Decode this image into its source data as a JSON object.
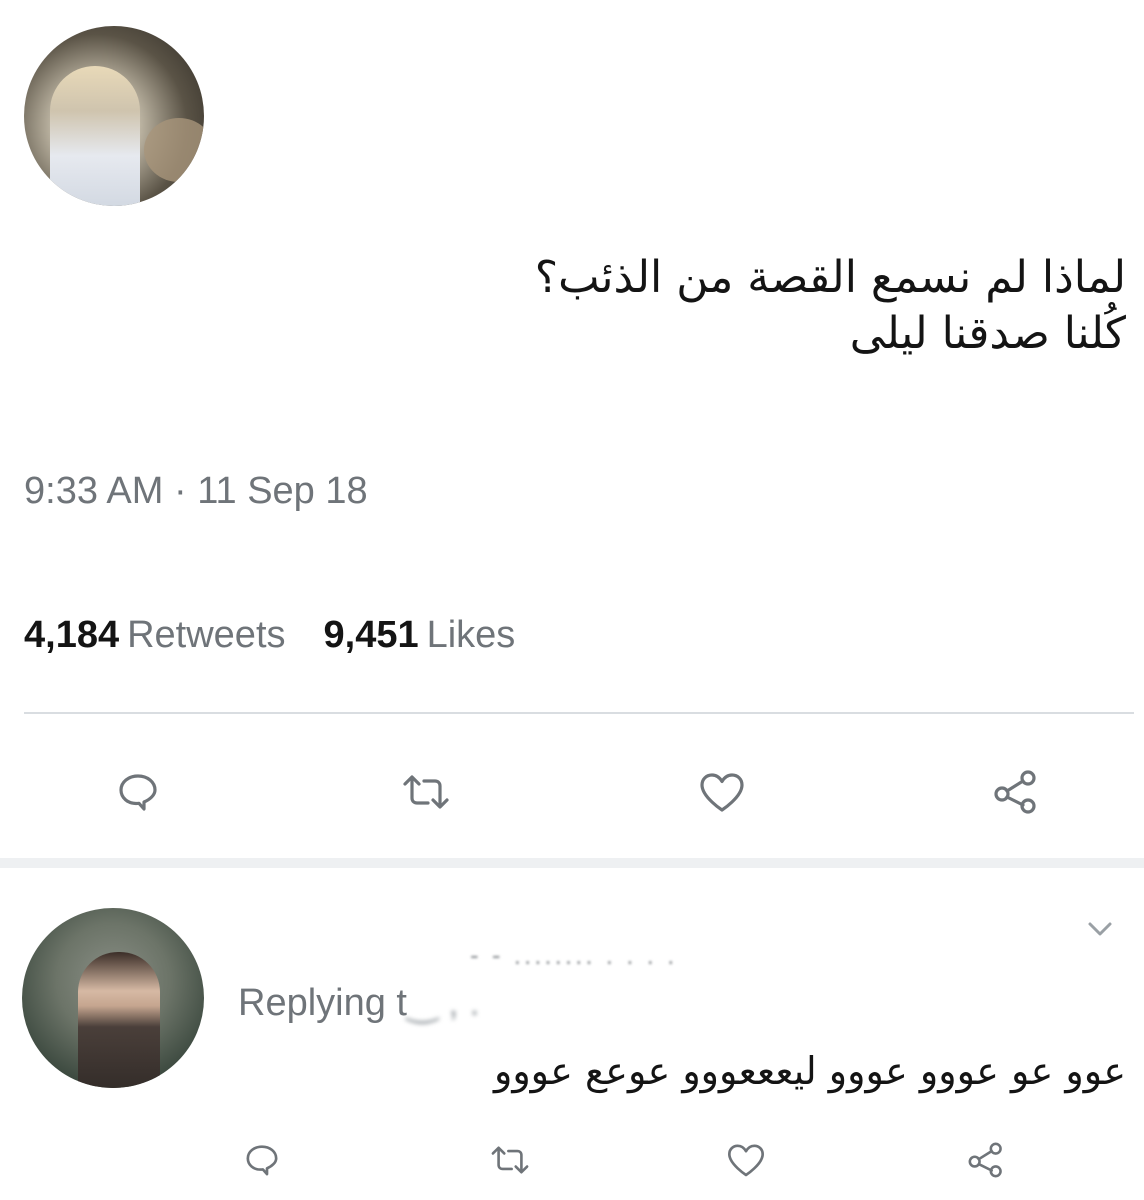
{
  "tweet": {
    "text_lines": [
      "لماذا لم نسمع القصة من الذئب؟",
      "كُلنا صدقنا ليلى"
    ],
    "timestamp": "9:33 AM · 11 Sep 18",
    "retweets_count": "4,184",
    "retweets_label": "Retweets",
    "likes_count": "9,451",
    "likes_label": "Likes"
  },
  "reply": {
    "handle_blurred": "- - ........   . . . .",
    "replying_label": "Replying t",
    "replying_blurred": "‿ ,  .",
    "text": "عوو عو عووو عووو ليعععووو عوعع عووو"
  },
  "icons": {
    "reply": "reply-icon",
    "retweet": "retweet-icon",
    "like": "heart-icon",
    "share": "share-icon",
    "more": "chevron-down-icon"
  },
  "colors": {
    "text": "#141414",
    "muted": "#6f7479",
    "divider": "#d9dde1"
  }
}
